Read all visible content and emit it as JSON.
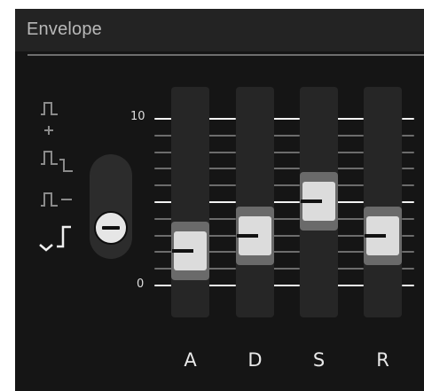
{
  "panel": {
    "title": "Envelope"
  },
  "mode_selector": {
    "icons": [
      "single-pulse-icon",
      "plus-icon",
      "double-pulse-icon",
      "pulse-sustain-icon",
      "wave-gate-icon"
    ],
    "plus_symbol": "+",
    "selected_index": 3
  },
  "scale": {
    "max_label": "10",
    "min_label": "0"
  },
  "faders": [
    {
      "label": "A",
      "value": 2.0
    },
    {
      "label": "D",
      "value": 2.9
    },
    {
      "label": "S",
      "value": 5.0
    },
    {
      "label": "R",
      "value": 2.9
    }
  ],
  "colors": {
    "background": "#151515",
    "header": "#232323",
    "track": "#262626",
    "cap": "#dcdcdc",
    "tick_major": "#f2f2f2"
  }
}
